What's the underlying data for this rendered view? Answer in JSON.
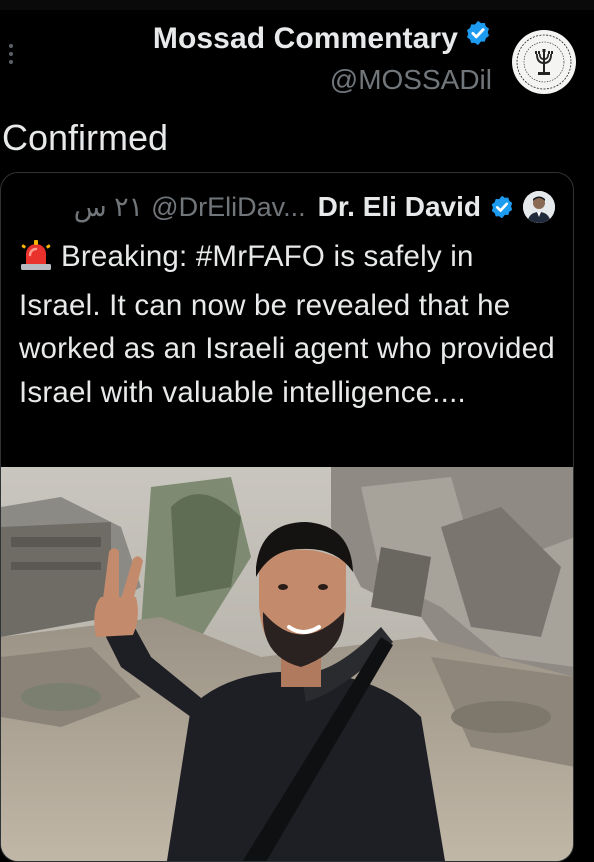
{
  "tweet": {
    "author_name": "Mossad Commentary",
    "author_handle": "@MOSSADil",
    "text": "Confirmed"
  },
  "quoted_tweet": {
    "author_name": "Dr. Eli David",
    "author_handle": "@DrEliDav...",
    "time": "٢١ س",
    "text": "Breaking: #MrFAFO is safely in Israel. It can now be revealed that he worked as an Israeli agent who provided Israel with valuable intelligence....",
    "siren_emoji": "🚨"
  },
  "colors": {
    "background": "#000000",
    "text": "#e7e9ea",
    "secondary_text": "#71767b",
    "verified_badge": "#1d9bf0",
    "card_border": "#2f3336"
  },
  "icons": {
    "more": "vertical-ellipsis-icon",
    "verified": "verified-badge-icon",
    "siren": "siren-emoji-icon"
  }
}
